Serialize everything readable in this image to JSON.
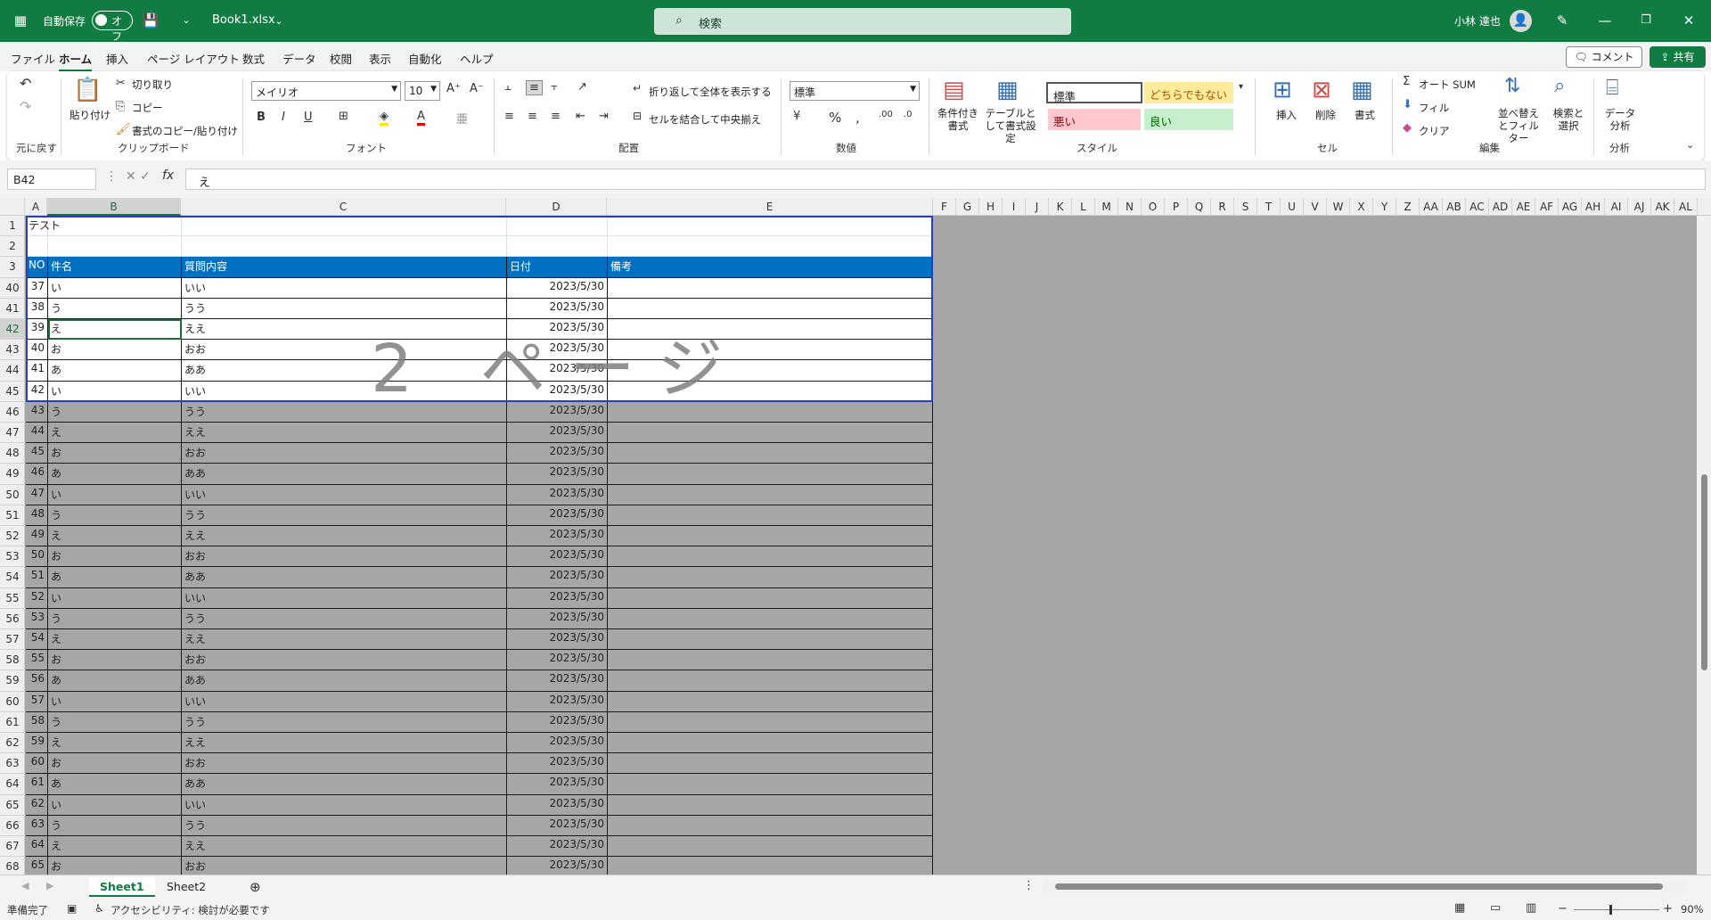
{
  "titlebar": {
    "autosave_label": "自動保存",
    "autosave_state": "オフ",
    "filename": "Book1.xlsx",
    "search_placeholder": "検索",
    "user_name": "小林 達也"
  },
  "menu": {
    "tabs": [
      "ファイル",
      "ホーム",
      "挿入",
      "ページ レイアウト",
      "数式",
      "データ",
      "校閲",
      "表示",
      "自動化",
      "ヘルプ"
    ],
    "active_tab": "ホーム",
    "comment_label": "コメント",
    "share_label": "共有"
  },
  "ribbon": {
    "undo_group": "元に戻す",
    "clipboard": {
      "group": "クリップボード",
      "paste": "貼り付け",
      "cut": "切り取り",
      "copy": "コピー",
      "format_painter": "書式のコピー/貼り付け"
    },
    "font": {
      "group": "フォント",
      "name": "メイリオ",
      "size": "10"
    },
    "alignment": {
      "group": "配置",
      "wrap": "折り返して全体を表示する",
      "merge": "セルを結合して中央揃え"
    },
    "number": {
      "group": "数値",
      "format": "標準"
    },
    "styles": {
      "group": "スタイル",
      "conditional": "条件付き書式",
      "table": "テーブルとして書式設定",
      "normal": "標準",
      "neutral": "どちらでもない",
      "bad": "悪い",
      "good": "良い"
    },
    "cells": {
      "group": "セル",
      "insert": "挿入",
      "delete": "削除",
      "format": "書式"
    },
    "editing": {
      "group": "編集",
      "autosum": "オート SUM",
      "fill": "フィル",
      "clear": "クリア",
      "sort": "並べ替えとフィルター",
      "find": "検索と選択"
    },
    "analysis": {
      "group": "分析",
      "data_analysis": "データ分析"
    }
  },
  "formula_bar": {
    "name_box": "B42",
    "formula": "え"
  },
  "columns": [
    "A",
    "B",
    "C",
    "D",
    "E",
    "F",
    "G",
    "H",
    "I",
    "J",
    "K",
    "L",
    "M",
    "N",
    "O",
    "P",
    "Q",
    "R",
    "S",
    "T",
    "U",
    "V",
    "W",
    "X",
    "Y",
    "Z",
    "AA",
    "AB",
    "AC",
    "AD",
    "AE",
    "AF",
    "AG",
    "AH",
    "AI",
    "AJ",
    "AK",
    "AL"
  ],
  "selected_column": "B",
  "rows": [
    {
      "row": "1",
      "no": "テスト",
      "name": "",
      "content": "",
      "date": "",
      "note": ""
    },
    {
      "row": "2",
      "no": "",
      "name": "",
      "content": "",
      "date": "",
      "note": ""
    },
    {
      "row": "3",
      "no": "NO",
      "name": "件名",
      "content": "質問内容",
      "date": "日付",
      "note": "備考",
      "header": true
    },
    {
      "row": "40",
      "no": "37",
      "name": "い",
      "content": "いい",
      "date": "2023/5/30",
      "note": ""
    },
    {
      "row": "41",
      "no": "38",
      "name": "う",
      "content": "うう",
      "date": "2023/5/30",
      "note": ""
    },
    {
      "row": "42",
      "no": "39",
      "name": "え",
      "content": "ええ",
      "date": "2023/5/30",
      "note": ""
    },
    {
      "row": "43",
      "no": "40",
      "name": "お",
      "content": "おお",
      "date": "2023/5/30",
      "note": ""
    },
    {
      "row": "44",
      "no": "41",
      "name": "あ",
      "content": "ああ",
      "date": "2023/5/30",
      "note": ""
    },
    {
      "row": "45",
      "no": "42",
      "name": "い",
      "content": "いい",
      "date": "2023/5/30",
      "note": ""
    },
    {
      "row": "46",
      "no": "43",
      "name": "う",
      "content": "うう",
      "date": "2023/5/30",
      "note": "",
      "gray": true
    },
    {
      "row": "47",
      "no": "44",
      "name": "え",
      "content": "ええ",
      "date": "2023/5/30",
      "note": "",
      "gray": true
    },
    {
      "row": "48",
      "no": "45",
      "name": "お",
      "content": "おお",
      "date": "2023/5/30",
      "note": "",
      "gray": true
    },
    {
      "row": "49",
      "no": "46",
      "name": "あ",
      "content": "ああ",
      "date": "2023/5/30",
      "note": "",
      "gray": true
    },
    {
      "row": "50",
      "no": "47",
      "name": "い",
      "content": "いい",
      "date": "2023/5/30",
      "note": "",
      "gray": true
    },
    {
      "row": "51",
      "no": "48",
      "name": "う",
      "content": "うう",
      "date": "2023/5/30",
      "note": "",
      "gray": true
    },
    {
      "row": "52",
      "no": "49",
      "name": "え",
      "content": "ええ",
      "date": "2023/5/30",
      "note": "",
      "gray": true
    },
    {
      "row": "53",
      "no": "50",
      "name": "お",
      "content": "おお",
      "date": "2023/5/30",
      "note": "",
      "gray": true
    },
    {
      "row": "54",
      "no": "51",
      "name": "あ",
      "content": "ああ",
      "date": "2023/5/30",
      "note": "",
      "gray": true
    },
    {
      "row": "55",
      "no": "52",
      "name": "い",
      "content": "いい",
      "date": "2023/5/30",
      "note": "",
      "gray": true
    },
    {
      "row": "56",
      "no": "53",
      "name": "う",
      "content": "うう",
      "date": "2023/5/30",
      "note": "",
      "gray": true
    },
    {
      "row": "57",
      "no": "54",
      "name": "え",
      "content": "ええ",
      "date": "2023/5/30",
      "note": "",
      "gray": true
    },
    {
      "row": "58",
      "no": "55",
      "name": "お",
      "content": "おお",
      "date": "2023/5/30",
      "note": "",
      "gray": true
    },
    {
      "row": "59",
      "no": "56",
      "name": "あ",
      "content": "ああ",
      "date": "2023/5/30",
      "note": "",
      "gray": true
    },
    {
      "row": "60",
      "no": "57",
      "name": "い",
      "content": "いい",
      "date": "2023/5/30",
      "note": "",
      "gray": true
    },
    {
      "row": "61",
      "no": "58",
      "name": "う",
      "content": "うう",
      "date": "2023/5/30",
      "note": "",
      "gray": true
    },
    {
      "row": "62",
      "no": "59",
      "name": "え",
      "content": "ええ",
      "date": "2023/5/30",
      "note": "",
      "gray": true
    },
    {
      "row": "63",
      "no": "60",
      "name": "お",
      "content": "おお",
      "date": "2023/5/30",
      "note": "",
      "gray": true
    },
    {
      "row": "64",
      "no": "61",
      "name": "あ",
      "content": "ああ",
      "date": "2023/5/30",
      "note": "",
      "gray": true
    },
    {
      "row": "65",
      "no": "62",
      "name": "い",
      "content": "いい",
      "date": "2023/5/30",
      "note": "",
      "gray": true
    },
    {
      "row": "66",
      "no": "63",
      "name": "う",
      "content": "うう",
      "date": "2023/5/30",
      "note": "",
      "gray": true
    },
    {
      "row": "67",
      "no": "64",
      "name": "え",
      "content": "ええ",
      "date": "2023/5/30",
      "note": "",
      "gray": true
    },
    {
      "row": "68",
      "no": "65",
      "name": "お",
      "content": "おお",
      "date": "2023/5/30",
      "note": "",
      "gray": true
    }
  ],
  "page_watermark": "2 ページ",
  "sheet_tabs": [
    "Sheet1",
    "Sheet2"
  ],
  "active_sheet": "Sheet1",
  "status": {
    "ready": "準備完了",
    "accessibility": "アクセシビリティ: 検討が必要です",
    "zoom": "90%"
  },
  "colors": {
    "title_green": "#107c41",
    "header_blue": "#0070c0",
    "page_border": "#2740b8",
    "outside_gray": "#a6a6a6"
  }
}
